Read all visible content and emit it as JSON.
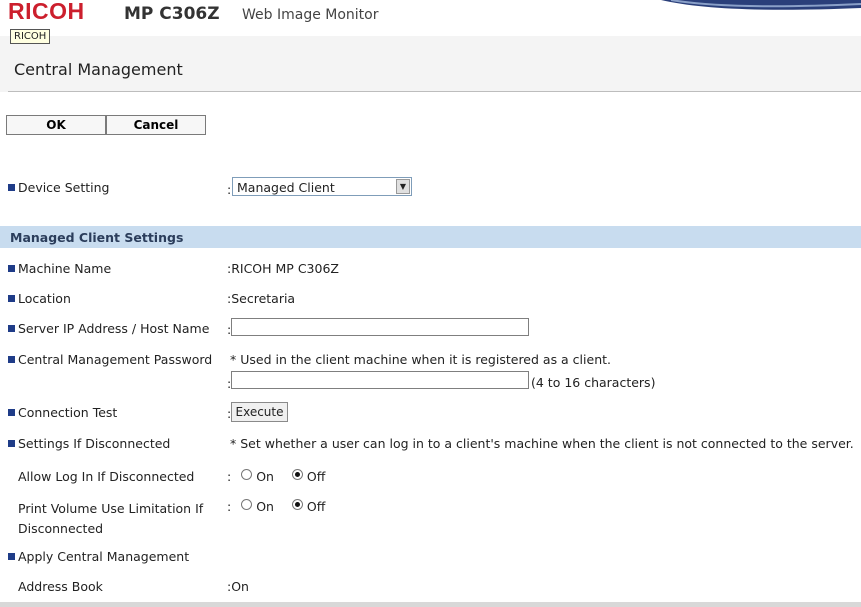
{
  "header": {
    "brand": "RICOH",
    "model": "MP C306Z",
    "product": "Web Image Monitor",
    "tooltip": "RICOH"
  },
  "page": {
    "title": "Central Management"
  },
  "buttons": {
    "ok": "OK",
    "cancel": "Cancel"
  },
  "device_setting": {
    "label": "Device Setting",
    "colon": ":",
    "value": "Managed Client"
  },
  "section": {
    "title": "Managed Client Settings"
  },
  "rows": {
    "machine_name": {
      "label": "Machine Name",
      "value": ":RICOH MP C306Z"
    },
    "location": {
      "label": "Location",
      "value": ":Secretaria"
    },
    "server": {
      "label": "Server IP Address / Host Name",
      "colon": ":",
      "value": ""
    },
    "password": {
      "label": "Central Management Password",
      "note": "* Used in the client machine when it is registered as a client.",
      "colon": ":",
      "value": "",
      "hint": "(4 to 16 characters)"
    },
    "connection_test": {
      "label": "Connection Test",
      "colon": ":",
      "button": "Execute"
    },
    "disconnected": {
      "label": "Settings If Disconnected",
      "note": "* Set whether a user can log in to a client's machine when the client is not connected to the server."
    },
    "allow_login": {
      "label": "Allow Log In If Disconnected",
      "colon": ":",
      "on": "On",
      "off": "Off",
      "selected": "Off"
    },
    "print_volume": {
      "label1": "Print Volume Use Limitation If",
      "label2": "Disconnected",
      "colon": ":",
      "on": "On",
      "off": "Off",
      "selected": "Off"
    },
    "apply": {
      "label": "Apply Central Management"
    },
    "address_book": {
      "label": "Address Book",
      "value": ":On"
    }
  },
  "colors": {
    "brand": "#cc1f2d",
    "section_bg": "#c8dcef",
    "bullet": "#1f3c88"
  }
}
